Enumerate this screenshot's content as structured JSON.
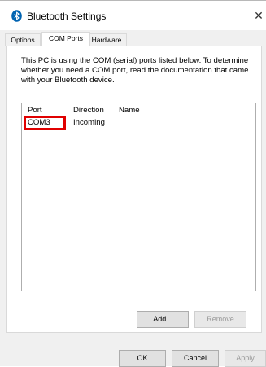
{
  "window": {
    "title": "Bluetooth Settings",
    "close_glyph": "✕"
  },
  "tabs": [
    {
      "label": "Options"
    },
    {
      "label": "COM Ports",
      "active": true
    },
    {
      "label": "Hardware"
    }
  ],
  "description": "This PC is using the COM (serial) ports listed below. To determine whether you need a COM port, read the documentation that came with your Bluetooth device.",
  "table": {
    "columns": [
      "Port",
      "Direction",
      "Name"
    ],
    "rows": [
      {
        "port": "COM3",
        "direction": "Incoming",
        "name": ""
      }
    ]
  },
  "panel_buttons": {
    "add": "Add...",
    "remove": "Remove"
  },
  "dialog_buttons": {
    "ok": "OK",
    "cancel": "Cancel",
    "apply": "Apply"
  },
  "colors": {
    "highlight": "#e00000",
    "bluetooth": "#0063b1"
  },
  "icons": {
    "title": "bluetooth-icon",
    "close": "close-icon"
  }
}
